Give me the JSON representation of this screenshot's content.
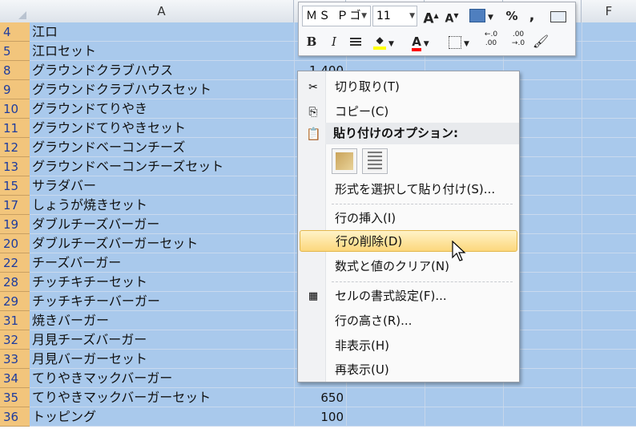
{
  "columns": {
    "a_label": "A",
    "f_label": "F"
  },
  "rows": [
    {
      "num": "4",
      "name": "江ロ",
      "value": ""
    },
    {
      "num": "5",
      "name": "江ロセット",
      "value": ""
    },
    {
      "num": "8",
      "name": "グラウンドクラブハウス",
      "value": "1,400"
    },
    {
      "num": "9",
      "name": "グラウンドクラブハウスセット",
      "value": ""
    },
    {
      "num": "10",
      "name": "グラウンドてりやき",
      "value": ""
    },
    {
      "num": "11",
      "name": "グラウンドてりやきセット",
      "value": ""
    },
    {
      "num": "12",
      "name": "グラウンドベーコンチーズ",
      "value": ""
    },
    {
      "num": "13",
      "name": "グラウンドベーコンチーズセット",
      "value": ""
    },
    {
      "num": "15",
      "name": "サラダバー",
      "value": ""
    },
    {
      "num": "17",
      "name": "しょうが焼きセット",
      "value": ""
    },
    {
      "num": "19",
      "name": "ダブルチーズバーガー",
      "value": ""
    },
    {
      "num": "20",
      "name": "ダブルチーズバーガーセット",
      "value": ""
    },
    {
      "num": "22",
      "name": "チーズバーガー",
      "value": ""
    },
    {
      "num": "28",
      "name": "チッチキチーセット",
      "value": ""
    },
    {
      "num": "29",
      "name": "チッチキチーバーガー",
      "value": ""
    },
    {
      "num": "31",
      "name": "焼きバーガー",
      "value": ""
    },
    {
      "num": "32",
      "name": "月見チーズバーガー",
      "value": ""
    },
    {
      "num": "33",
      "name": "月見バーガーセット",
      "value": ""
    },
    {
      "num": "34",
      "name": "てりやきマックバーガー",
      "value": ""
    },
    {
      "num": "35",
      "name": "てりやきマックバーガーセット",
      "value": "650"
    },
    {
      "num": "36",
      "name": "トッピング",
      "value": "100"
    }
  ],
  "mini_toolbar": {
    "font_name": "ＭＳ Ｐゴ",
    "font_size": "11",
    "grow_font": "A",
    "shrink_font": "A",
    "percent": "%",
    "comma": ",",
    "bold": "B",
    "italic": "I",
    "font_color": "A",
    "inc_decimal": "←.0\n.00",
    "dec_decimal": ".00\n→.0",
    "icons": [
      "table-format-icon",
      "center-align-icon",
      "fill-color-icon",
      "borders-icon",
      "format-painter-icon",
      "merge-center-icon"
    ],
    "accent_colors": {
      "fill": "#ffff00",
      "font": "#ff0000"
    }
  },
  "context_menu": {
    "cut": "切り取り(T)",
    "copy": "コピー(C)",
    "paste_options_header": "貼り付けのオプション:",
    "paste_special": "形式を選択して貼り付け(S)...",
    "insert_row": "行の挿入(I)",
    "delete_row": "行の削除(D)",
    "clear_contents": "数式と値のクリア(N)",
    "format_cells": "セルの書式設定(F)...",
    "row_height": "行の高さ(R)...",
    "hide": "非表示(H)",
    "unhide": "再表示(U)",
    "highlighted_item": "delete_row"
  },
  "colors": {
    "selection": "#a9c9ec",
    "row_header_selected": "#f2c57c",
    "row_number_text": "#1e3c9e",
    "menu_highlight": "#fcd77c"
  }
}
